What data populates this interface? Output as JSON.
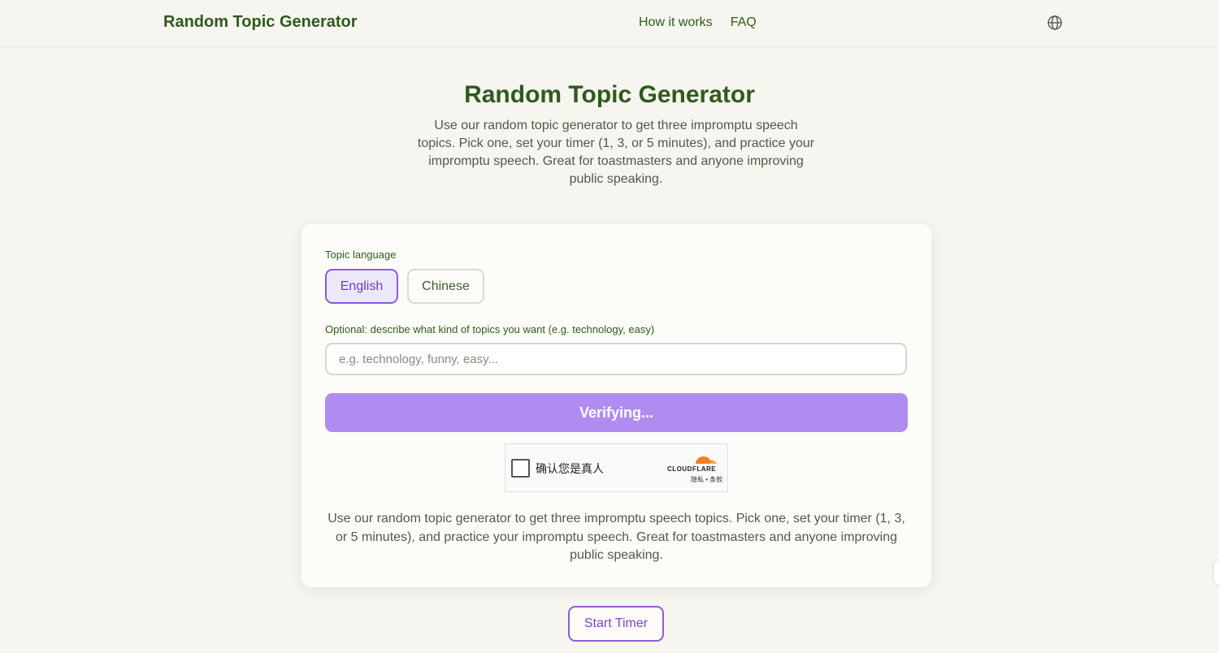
{
  "header": {
    "brand": "Random Topic Generator",
    "nav": [
      "How it works",
      "FAQ"
    ],
    "language_icon": "globe-icon"
  },
  "hero": {
    "title": "Random Topic Generator",
    "description": "Use our random topic generator to get three impromptu speech topics. Pick one, set your timer (1, 3, or 5 minutes), and practice your impromptu speech. Great for toastmasters and anyone improving public speaking."
  },
  "card": {
    "language_label": "Topic language",
    "languages": [
      "English",
      "Chinese"
    ],
    "selected_language": "English",
    "topic_label": "Optional: describe what kind of topics you want (e.g. technology, easy)",
    "topic_placeholder": "e.g. technology, funny, easy...",
    "topic_value": "",
    "generate_button": "Verifying...",
    "captcha": {
      "label": "确认您是真人",
      "brand": "CLOUDFLARE",
      "links": "隐私 • 条款"
    },
    "description": "Use our random topic generator to get three impromptu speech topics. Pick one, set your timer (1, 3, or 5 minutes), and practice your impromptu speech. Great for toastmasters and anyone improving public speaking."
  },
  "timer_button": "Start Timer",
  "colors": {
    "background": "#f7f5ef",
    "brand_green": "#2f5a1e",
    "accent_purple": "#8e5bd8",
    "button_purple": "#b18cf0",
    "cloudflare_orange": "#f38020"
  }
}
